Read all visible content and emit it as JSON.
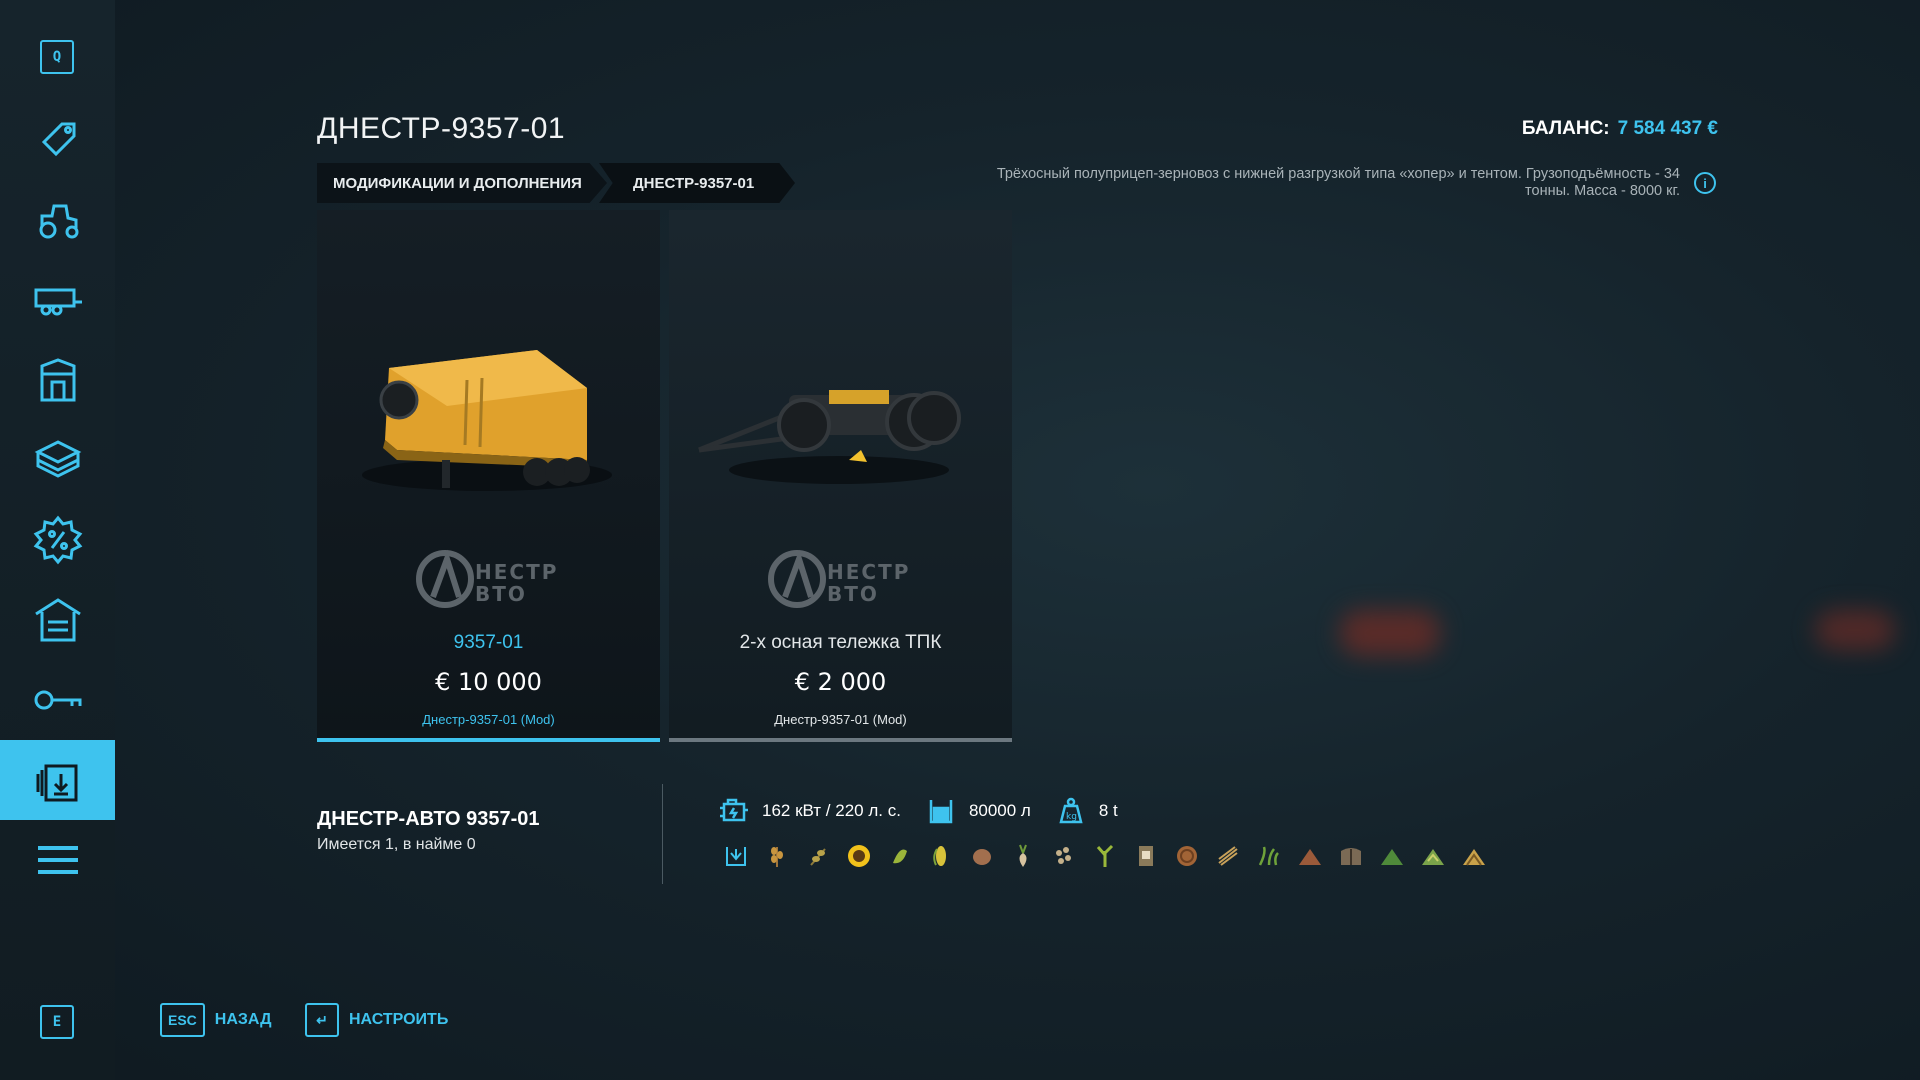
{
  "sidebar": {
    "top_key": "Q",
    "bottom_key": "E",
    "items": [
      {
        "icon": "price-tag-icon"
      },
      {
        "icon": "tractor-icon"
      },
      {
        "icon": "trailer-icon"
      },
      {
        "icon": "silo-icon"
      },
      {
        "icon": "pallet-box-icon"
      },
      {
        "icon": "sale-percent-icon"
      },
      {
        "icon": "shed-icon"
      },
      {
        "icon": "key-icon"
      },
      {
        "icon": "mods-download-icon",
        "active": true
      },
      {
        "icon": "menu-icon"
      }
    ]
  },
  "header": {
    "title": "ДНЕСТР-9357-01",
    "balance_label": "БАЛАНС:",
    "balance_value": "7 584 437 €",
    "description_line1": "Трёхосный полуприцеп-зерновоз с нижней разгрузкой типа «хопер» и тентом. Грузоподъёмность - 34",
    "description_line2": "тонны. Масса - 8000 кг."
  },
  "breadcrumb": [
    {
      "label": "МОДИФИКАЦИИ И ДОПОЛНЕНИЯ"
    },
    {
      "label": "ДНЕСТР-9357-01"
    }
  ],
  "cards": [
    {
      "name": "9357-01",
      "price": "€ 10 000",
      "source": "Днестр-9357-01 (Mod)",
      "selected": true,
      "brand": "ДНЕСТР АВТО"
    },
    {
      "name": "2-х осная тележка ТПК",
      "price": "€ 2 000",
      "source": "Днестр-9357-01 (Mod)",
      "selected": false,
      "brand": "ДНЕСТР АВТО"
    }
  ],
  "details": {
    "title": "ДНЕСТР-АВТО 9357-01",
    "subtitle": "Имеется 1, в найме 0",
    "power": "162 кВт / 220 л. с.",
    "capacity": "80000 л",
    "weight": "8 t"
  },
  "footer": {
    "back_key": "ESC",
    "back_label": "НАЗАД",
    "configure_key": "↵",
    "configure_label": "НАСТРОИТЬ"
  },
  "colors": {
    "accent": "#3ec3ee",
    "background": "#15232b"
  }
}
